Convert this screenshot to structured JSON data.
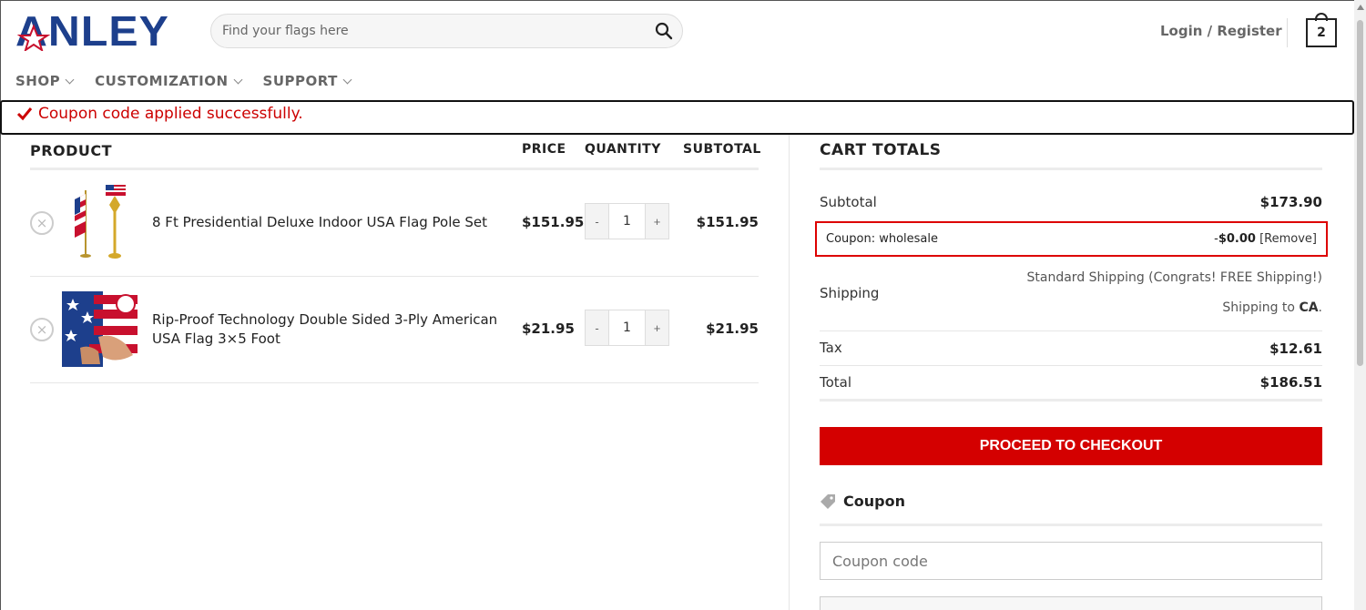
{
  "header": {
    "logo_text": "ANLEY",
    "search_placeholder": "Find your flags here",
    "login_label": "Login / Register",
    "cart_count": "2"
  },
  "nav": {
    "items": [
      {
        "label": "SHOP"
      },
      {
        "label": "CUSTOMIZATION"
      },
      {
        "label": "SUPPORT"
      }
    ]
  },
  "notice": {
    "message": "Coupon code applied successfully.",
    "color": "#cc0000"
  },
  "cart_table": {
    "headers": {
      "product": "PRODUCT",
      "price": "PRICE",
      "quantity": "QUANTITY",
      "subtotal": "SUBTOTAL"
    },
    "rows": [
      {
        "name": "8 Ft Presidential Deluxe Indoor USA Flag Pole Set",
        "price": "$151.95",
        "quantity": "1",
        "subtotal": "$151.95"
      },
      {
        "name": "Rip-Proof Technology Double Sided 3-Ply American USA Flag 3×5 Foot",
        "price": "$21.95",
        "quantity": "1",
        "subtotal": "$21.95"
      }
    ],
    "remove_symbol": "×",
    "minus_symbol": "-",
    "plus_symbol": "+"
  },
  "totals": {
    "title": "CART TOTALS",
    "subtotal_label": "Subtotal",
    "subtotal_value": "$173.90",
    "coupon_label": "Coupon: wholesale",
    "coupon_prefix": "-",
    "coupon_value": "$0.00",
    "coupon_remove": "[Remove]",
    "shipping_label": "Shipping",
    "shipping_option": "Standard Shipping (Congrats! FREE Shipping!)",
    "shipping_to_prefix": "Shipping to ",
    "shipping_to_state": "CA",
    "shipping_to_suffix": ".",
    "tax_label": "Tax",
    "tax_value": "$12.61",
    "total_label": "Total",
    "total_value": "$186.51",
    "checkout_label": "PROCEED TO CHECKOUT",
    "checkout_color": "#d40000"
  },
  "coupon": {
    "heading": "Coupon",
    "placeholder": "Coupon code"
  }
}
